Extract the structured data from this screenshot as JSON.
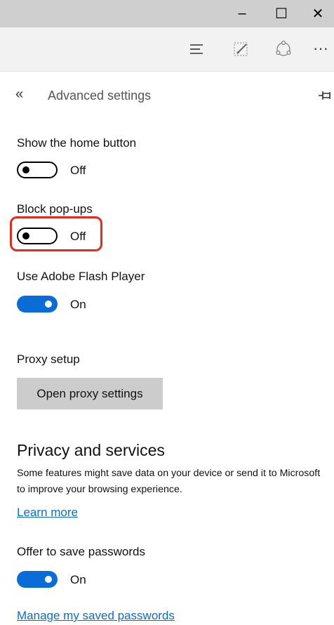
{
  "window": {
    "minimize_glyph": "–",
    "maximize_glyph": "☐",
    "close_glyph": "✕"
  },
  "toolbar": {
    "more_glyph": "···",
    "icons": [
      "hub-icon",
      "web-note-icon",
      "share-icon",
      "more-icon"
    ]
  },
  "panel": {
    "back_glyph": "«",
    "title": "Advanced settings"
  },
  "settings": {
    "home_button": {
      "label": "Show the home button",
      "state": "Off",
      "on": false
    },
    "block_popups": {
      "label": "Block pop-ups",
      "state": "Off",
      "on": false
    },
    "flash": {
      "label": "Use Adobe Flash Player",
      "state": "On",
      "on": true
    },
    "proxy": {
      "label": "Proxy setup",
      "button": "Open proxy settings"
    }
  },
  "privacy": {
    "title": "Privacy and services",
    "description": "Some features might save data on your device or send it to Microsoft to improve your browsing experience.",
    "learn_more": "Learn more",
    "offer_passwords": {
      "label": "Offer to save passwords",
      "state": "On",
      "on": true
    },
    "manage_link": "Manage my saved passwords"
  },
  "colors": {
    "accent": "#0a6cd6",
    "highlight": "#e52b1f",
    "titlebar": "#cfcfcf",
    "toolbar": "#f2f2f2",
    "button": "#cccccc"
  }
}
